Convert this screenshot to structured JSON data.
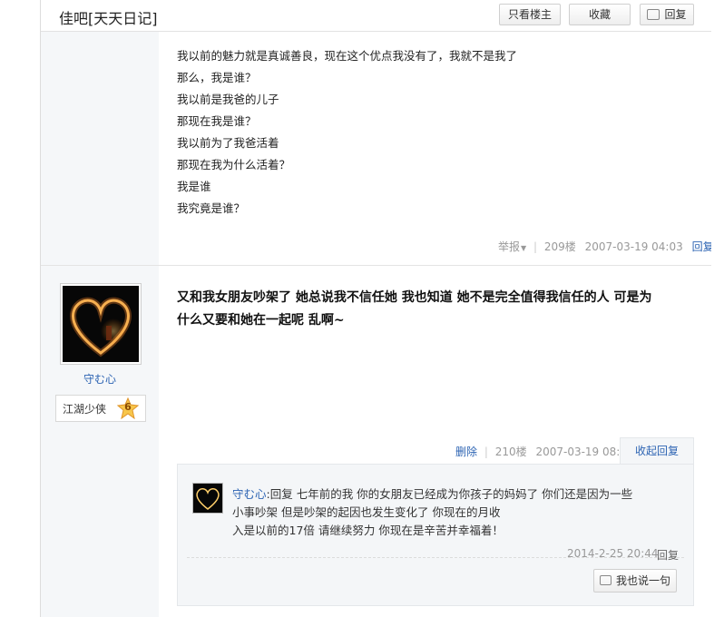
{
  "header": {
    "forum_title": "佳吧[天天日记]",
    "only_author_label": "只看楼主",
    "favorite_label": "收藏",
    "reply_label": "回复"
  },
  "floor209": {
    "lines": [
      "我以前的魅力就是真诚善良，现在这个优点我没有了，我就不是我了",
      "那么，我是谁？",
      "我以前是我爸的儿子",
      "那现在我是谁？",
      "我以前为了我爸活着",
      "那现在我为什么活着？",
      "我是谁",
      "我究竟是谁？"
    ],
    "report_label": "举报",
    "floor_num": "209楼",
    "datetime": "2007-03-19 04:03",
    "reply_link": "回复"
  },
  "floor210": {
    "username": "守む心",
    "level_name": "江湖少侠",
    "level_num": "6",
    "content_lines": [
      "又和我女朋友吵架了 她总说我不信任她 我也知道 她不是完全值得我信任的人 可是为",
      "什么又要和她在一起呢 乱啊~"
    ],
    "delete_label": "删除",
    "floor_num": "210楼",
    "datetime": "2007-03-19 08:07",
    "collapse_reply_label": "收起回复",
    "lzl": {
      "user": "守む心",
      "text_lines": [
        "回复 七年前的我 你的女朋友已经成为你孩子的妈妈了 你们还是因为一些",
        "小事吵架 但是吵架的起因也发生变化了 你现在的月收",
        "入是以前的17倍 请继续努力 你现在是辛苦并幸福着！"
      ],
      "datetime": "2014-2-25 20:44",
      "reply_link": "回复",
      "say_button_label": "我也说一句"
    }
  },
  "colors": {
    "link": "#2d64b3",
    "meta": "#999999",
    "sidebar_bg": "#f5f7f9"
  }
}
